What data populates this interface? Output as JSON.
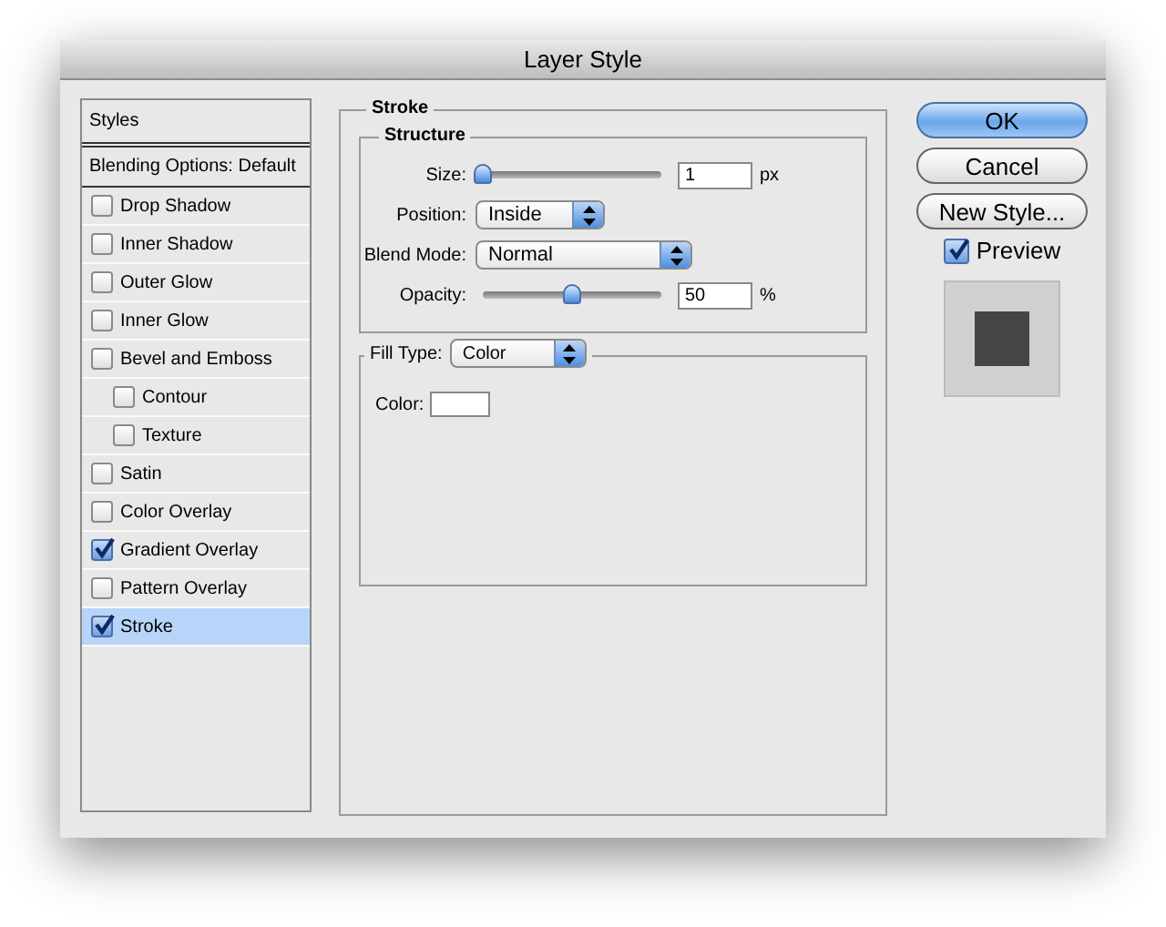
{
  "window": {
    "title": "Layer Style"
  },
  "styles_list": {
    "header": "Styles",
    "blending_options": "Blending Options: Default",
    "items": [
      {
        "label": "Drop Shadow",
        "checked": false,
        "selected": false
      },
      {
        "label": "Inner Shadow",
        "checked": false,
        "selected": false
      },
      {
        "label": "Outer Glow",
        "checked": false,
        "selected": false
      },
      {
        "label": "Inner Glow",
        "checked": false,
        "selected": false
      },
      {
        "label": "Bevel and Emboss",
        "checked": false,
        "selected": false,
        "children": [
          {
            "label": "Contour",
            "checked": false,
            "selected": false
          },
          {
            "label": "Texture",
            "checked": false,
            "selected": false
          }
        ]
      },
      {
        "label": "Satin",
        "checked": false,
        "selected": false
      },
      {
        "label": "Color Overlay",
        "checked": false,
        "selected": false
      },
      {
        "label": "Gradient Overlay",
        "checked": true,
        "selected": false
      },
      {
        "label": "Pattern Overlay",
        "checked": false,
        "selected": false
      },
      {
        "label": "Stroke",
        "checked": true,
        "selected": true
      }
    ]
  },
  "stroke": {
    "title": "Stroke",
    "structure": {
      "title": "Structure",
      "rows": [
        {
          "kind": "slider",
          "label": "Size:",
          "level": 0.0,
          "value": "1",
          "unit": "px"
        },
        {
          "kind": "select",
          "label": "Position:",
          "value": "Inside"
        },
        {
          "kind": "select",
          "label": "Blend Mode:",
          "value": "Normal"
        },
        {
          "kind": "slider",
          "label": "Opacity:",
          "level": 0.5,
          "value": "50",
          "unit": "%"
        }
      ]
    },
    "fill_type": {
      "label": "Fill Type:",
      "value": "Color"
    },
    "color": {
      "label": "Color:"
    }
  },
  "buttons": [
    {
      "label": "OK",
      "default": true
    },
    {
      "label": "Cancel",
      "default": false
    },
    {
      "label": "New Style...",
      "default": false
    }
  ],
  "preview": {
    "label": "Preview",
    "checked": true
  }
}
